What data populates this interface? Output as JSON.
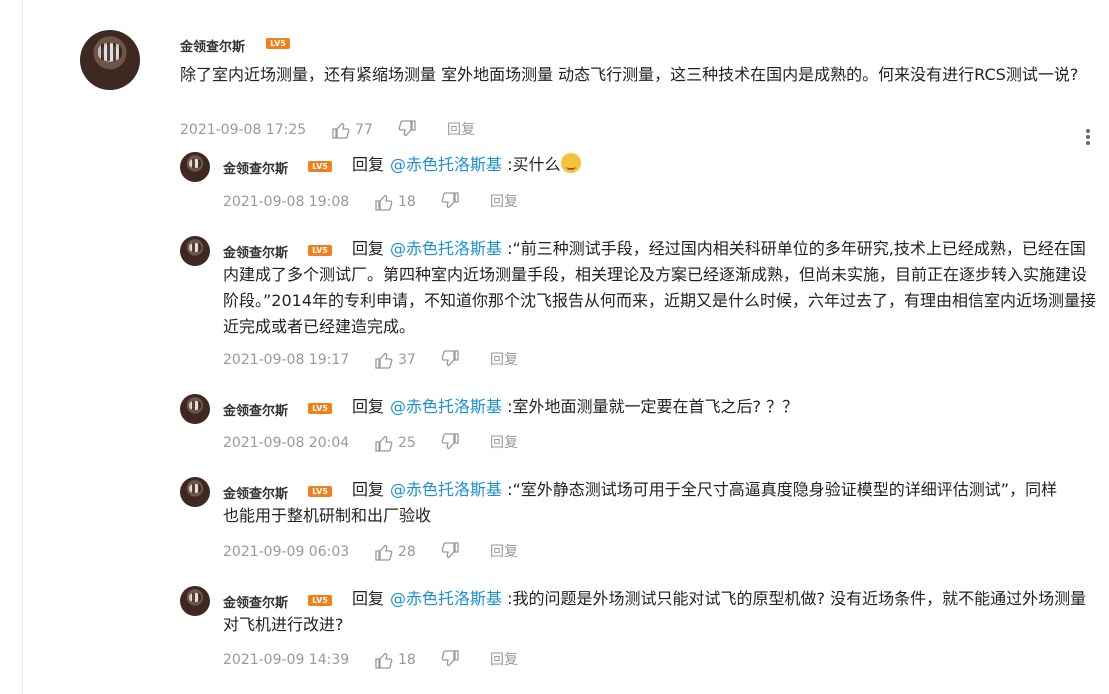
{
  "main_comment": {
    "username": "金领查尔斯",
    "level_badge": "LV5",
    "text": "除了室内近场测量，还有紧缩场测量 室外地面场测量 动态飞行测量，这三种技术在国内是成熟的。何来没有进行RCS测试一说?",
    "timestamp": "2021-09-08 17:25",
    "likes": "77",
    "reply_label": "回复"
  },
  "replies": [
    {
      "username": "金领查尔斯",
      "level_badge": "LV5",
      "reply_prefix": "回复",
      "mention": "@赤色托洛斯基",
      "text": ":买什么",
      "timestamp": "2021-09-08 19:08",
      "likes": "18",
      "reply_label": "回复"
    },
    {
      "username": "金领查尔斯",
      "level_badge": "LV5",
      "reply_prefix": "回复",
      "mention": "@赤色托洛斯基",
      "text": ":“前三种测试手段，经过国内相关科研单位的多年研究,技术上已经成熟，已经在国内建成了多个测试厂。第四种室内近场测量手段，相关理论及方案已经逐渐成熟，但尚未实施，目前正在逐步转入实施建设阶段。”2014年的专利申请，不知道你那个沈飞报告从何而来，近期又是什么时候，六年过去了，有理由相信室内近场测量接近完成或者已经建造完成。",
      "timestamp": "2021-09-08 19:17",
      "likes": "37",
      "reply_label": "回复"
    },
    {
      "username": "金领查尔斯",
      "level_badge": "LV5",
      "reply_prefix": "回复",
      "mention": "@赤色托洛斯基",
      "text": ":室外地面测量就一定要在首飞之后? ？？",
      "timestamp": "2021-09-08 20:04",
      "likes": "25",
      "reply_label": "回复"
    },
    {
      "username": "金领查尔斯",
      "level_badge": "LV5",
      "reply_prefix": "回复",
      "mention": "@赤色托洛斯基",
      "text": ":“室外静态测试场可用于全尺寸高逼真度隐身验证模型的详细评估测试”，同样也能用于整机研制和出厂验收",
      "timestamp": "2021-09-09 06:03",
      "likes": "28",
      "reply_label": "回复"
    },
    {
      "username": "金领查尔斯",
      "level_badge": "LV5",
      "reply_prefix": "回复",
      "mention": "@赤色托洛斯基",
      "text": ":我的问题是外场测试只能对试飞的原型机做? 没有近场条件，就不能通过外场测量对飞机进行改进?",
      "timestamp": "2021-09-09 14:39",
      "likes": "18",
      "reply_label": "回复"
    }
  ]
}
